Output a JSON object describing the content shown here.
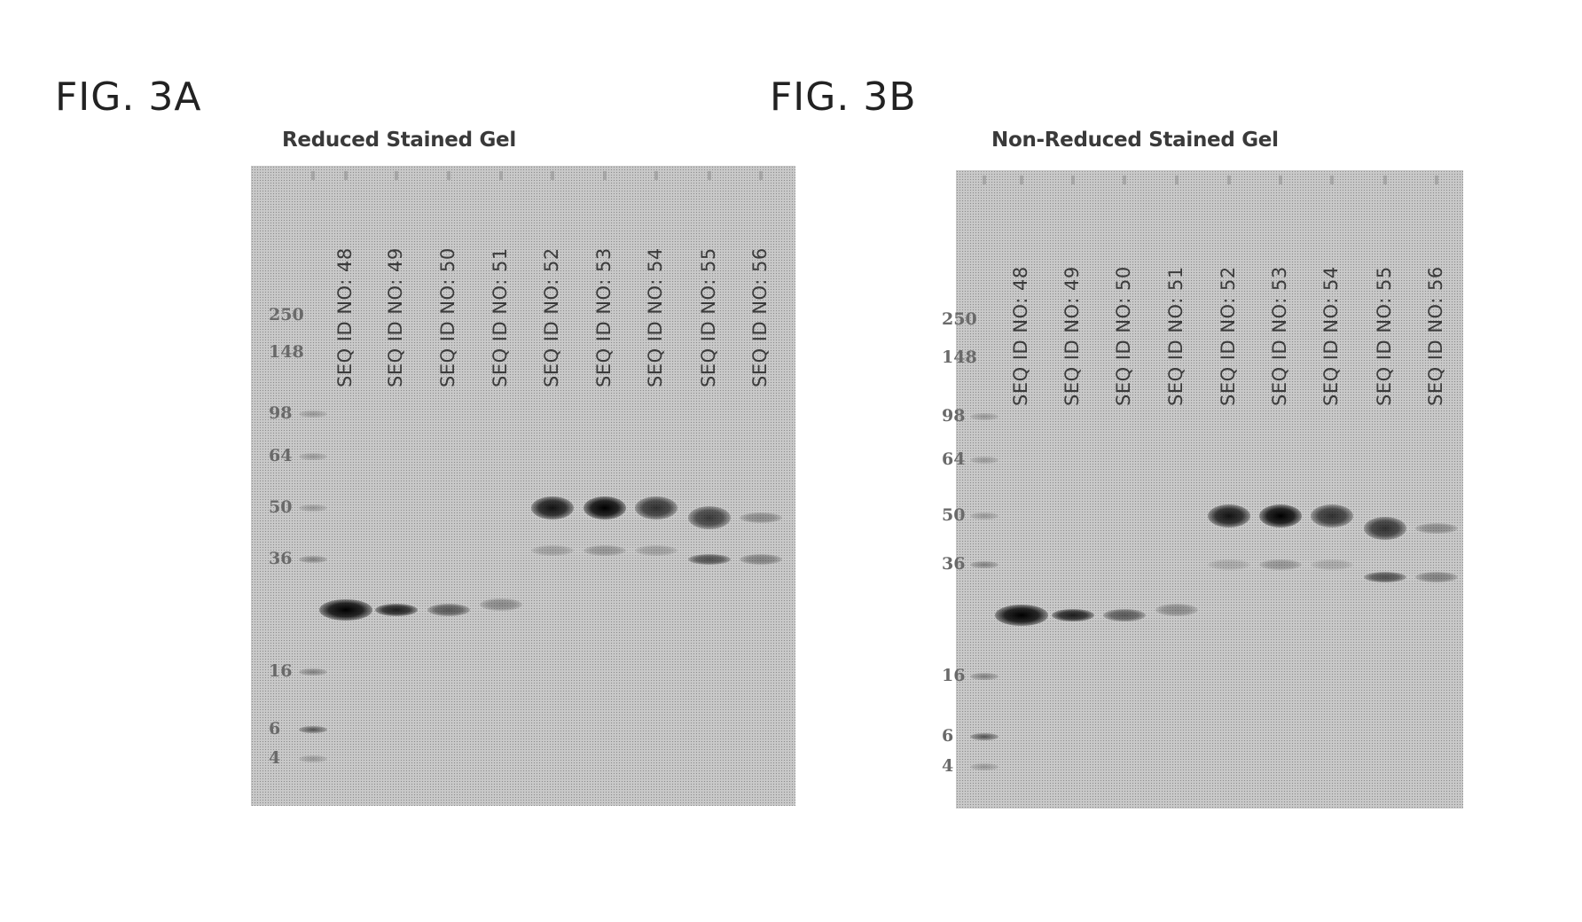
{
  "figures": [
    {
      "id": "A",
      "label": "FIG. 3A",
      "title": "Reduced Stained Gel",
      "markers": [
        "250",
        "148",
        "98",
        "64",
        "50",
        "36",
        "16",
        "6",
        "4"
      ],
      "lanes": [
        "SEQ ID NO: 48",
        "SEQ ID NO: 49",
        "SEQ ID NO: 50",
        "SEQ ID NO: 51",
        "SEQ ID NO: 52",
        "SEQ ID NO: 53",
        "SEQ ID NO: 54",
        "SEQ ID NO: 55",
        "SEQ ID NO: 56"
      ]
    },
    {
      "id": "B",
      "label": "FIG. 3B",
      "title": "Non-Reduced Stained Gel",
      "markers": [
        "250",
        "148",
        "98",
        "64",
        "50",
        "36",
        "16",
        "6",
        "4"
      ],
      "lanes": [
        "SEQ ID NO: 48",
        "SEQ ID NO: 49",
        "SEQ ID NO: 50",
        "SEQ ID NO: 51",
        "SEQ ID NO: 52",
        "SEQ ID NO: 53",
        "SEQ ID NO: 54",
        "SEQ ID NO: 55",
        "SEQ ID NO: 56"
      ]
    }
  ],
  "marker_unit_note": "kDa ladder values as printed",
  "band_intensity": {
    "A": {
      "lane_bands": [
        {
          "lane": "SEQ ID NO: 48",
          "bands": [
            {
              "kDa_approx": 25,
              "intensity": 1.0
            }
          ]
        },
        {
          "lane": "SEQ ID NO: 49",
          "bands": [
            {
              "kDa_approx": 25,
              "intensity": 0.85
            }
          ]
        },
        {
          "lane": "SEQ ID NO: 50",
          "bands": [
            {
              "kDa_approx": 25,
              "intensity": 0.55
            }
          ]
        },
        {
          "lane": "SEQ ID NO: 51",
          "bands": [
            {
              "kDa_approx": 26,
              "intensity": 0.3
            }
          ]
        },
        {
          "lane": "SEQ ID NO: 52",
          "bands": [
            {
              "kDa_approx": 50,
              "intensity": 0.9
            },
            {
              "kDa_approx": 38,
              "intensity": 0.2
            }
          ]
        },
        {
          "lane": "SEQ ID NO: 53",
          "bands": [
            {
              "kDa_approx": 50,
              "intensity": 1.0
            },
            {
              "kDa_approx": 38,
              "intensity": 0.25
            }
          ]
        },
        {
          "lane": "SEQ ID NO: 54",
          "bands": [
            {
              "kDa_approx": 50,
              "intensity": 0.75
            },
            {
              "kDa_approx": 38,
              "intensity": 0.2
            }
          ]
        },
        {
          "lane": "SEQ ID NO: 55",
          "bands": [
            {
              "kDa_approx": 47,
              "intensity": 0.7
            },
            {
              "kDa_approx": 36,
              "intensity": 0.6
            }
          ]
        },
        {
          "lane": "SEQ ID NO: 56",
          "bands": [
            {
              "kDa_approx": 47,
              "intensity": 0.3
            },
            {
              "kDa_approx": 36,
              "intensity": 0.35
            }
          ]
        }
      ]
    },
    "B": {
      "lane_bands": [
        {
          "lane": "SEQ ID NO: 48",
          "bands": [
            {
              "kDa_approx": 25,
              "intensity": 1.0
            }
          ]
        },
        {
          "lane": "SEQ ID NO: 49",
          "bands": [
            {
              "kDa_approx": 25,
              "intensity": 0.85
            }
          ]
        },
        {
          "lane": "SEQ ID NO: 50",
          "bands": [
            {
              "kDa_approx": 25,
              "intensity": 0.55
            }
          ]
        },
        {
          "lane": "SEQ ID NO: 51",
          "bands": [
            {
              "kDa_approx": 26,
              "intensity": 0.3
            }
          ]
        },
        {
          "lane": "SEQ ID NO: 52",
          "bands": [
            {
              "kDa_approx": 50,
              "intensity": 0.9
            },
            {
              "kDa_approx": 36,
              "intensity": 0.15
            }
          ]
        },
        {
          "lane": "SEQ ID NO: 53",
          "bands": [
            {
              "kDa_approx": 50,
              "intensity": 1.0
            },
            {
              "kDa_approx": 36,
              "intensity": 0.25
            }
          ]
        },
        {
          "lane": "SEQ ID NO: 54",
          "bands": [
            {
              "kDa_approx": 50,
              "intensity": 0.75
            },
            {
              "kDa_approx": 36,
              "intensity": 0.15
            }
          ]
        },
        {
          "lane": "SEQ ID NO: 55",
          "bands": [
            {
              "kDa_approx": 46,
              "intensity": 0.75
            },
            {
              "kDa_approx": 33,
              "intensity": 0.6
            }
          ]
        },
        {
          "lane": "SEQ ID NO: 56",
          "bands": [
            {
              "kDa_approx": 46,
              "intensity": 0.3
            },
            {
              "kDa_approx": 33,
              "intensity": 0.35
            }
          ]
        }
      ]
    }
  }
}
